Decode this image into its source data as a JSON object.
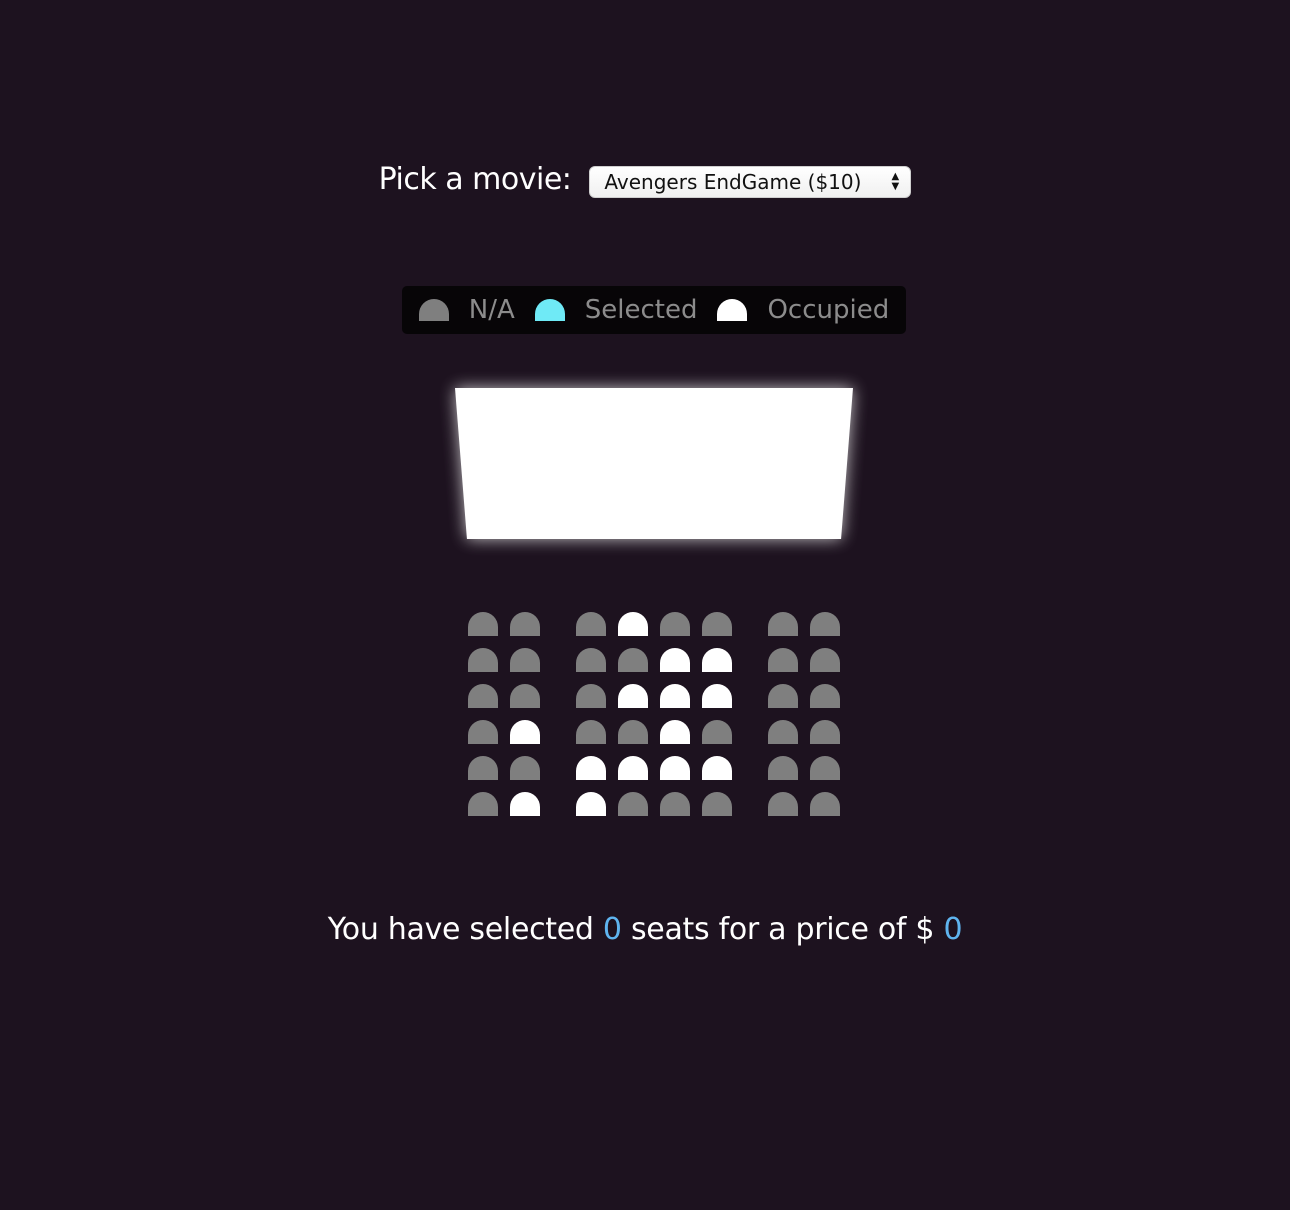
{
  "movie_picker": {
    "label": "Pick a movie:",
    "selected": "Avengers EndGame ($10)"
  },
  "legend": {
    "items": [
      {
        "label": "N/A",
        "state": "na"
      },
      {
        "label": "Selected",
        "state": "selected"
      },
      {
        "label": "Occupied",
        "state": "occupied"
      }
    ]
  },
  "seating": {
    "rows": [
      [
        "na",
        "na",
        "na",
        "occupied",
        "na",
        "na",
        "na",
        "na"
      ],
      [
        "na",
        "na",
        "na",
        "na",
        "occupied",
        "occupied",
        "na",
        "na"
      ],
      [
        "na",
        "na",
        "na",
        "occupied",
        "occupied",
        "occupied",
        "na",
        "na"
      ],
      [
        "na",
        "occupied",
        "na",
        "na",
        "occupied",
        "na",
        "na",
        "na"
      ],
      [
        "na",
        "na",
        "occupied",
        "occupied",
        "occupied",
        "occupied",
        "na",
        "na"
      ],
      [
        "na",
        "occupied",
        "occupied",
        "na",
        "na",
        "na",
        "na",
        "na"
      ]
    ]
  },
  "summary": {
    "prefix": "You have selected",
    "count": "0",
    "middle": "seats for a price of $",
    "total": "0"
  },
  "colors": {
    "background": "#1d121f",
    "seat_na": "#7f7f7f",
    "seat_selected": "#6feaf6",
    "seat_occupied": "#ffffff",
    "accent_number": "#5fb4ef"
  }
}
